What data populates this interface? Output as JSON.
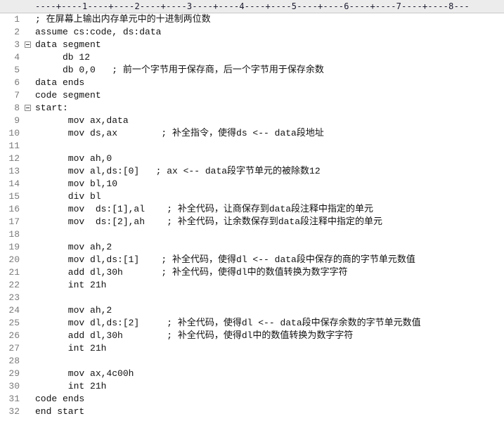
{
  "ruler": "----+----1----+----2----+----3----+----4----+----5----+----6----+----7----+----8---",
  "lines": [
    {
      "num": "1",
      "text": "; 在屏幕上输出内存单元中的十进制两位数",
      "fold": false
    },
    {
      "num": "2",
      "text": "assume cs:code, ds:data",
      "fold": false
    },
    {
      "num": "3",
      "text": "data segment",
      "fold": true
    },
    {
      "num": "4",
      "text": "     db 12",
      "fold": false
    },
    {
      "num": "5",
      "text": "     db 0,0   ; 前一个字节用于保存商，后一个字节用于保存余数",
      "fold": false
    },
    {
      "num": "6",
      "text": "data ends",
      "fold": false
    },
    {
      "num": "7",
      "text": "code segment",
      "fold": false
    },
    {
      "num": "8",
      "text": "start:",
      "fold": true
    },
    {
      "num": "9",
      "text": "      mov ax,data",
      "fold": false
    },
    {
      "num": "10",
      "text": "      mov ds,ax        ; 补全指令，使得ds <-- data段地址",
      "fold": false
    },
    {
      "num": "11",
      "text": "",
      "fold": false
    },
    {
      "num": "12",
      "text": "      mov ah,0",
      "fold": false
    },
    {
      "num": "13",
      "text": "      mov al,ds:[0]   ; ax <-- data段字节单元的被除数12",
      "fold": false
    },
    {
      "num": "14",
      "text": "      mov bl,10",
      "fold": false
    },
    {
      "num": "15",
      "text": "      div bl",
      "fold": false
    },
    {
      "num": "16",
      "text": "      mov  ds:[1],al    ; 补全代码，让商保存到data段注释中指定的单元",
      "fold": false
    },
    {
      "num": "17",
      "text": "      mov  ds:[2],ah    ; 补全代码，让余数保存到data段注释中指定的单元",
      "fold": false
    },
    {
      "num": "18",
      "text": "",
      "fold": false
    },
    {
      "num": "19",
      "text": "      mov ah,2",
      "fold": false
    },
    {
      "num": "20",
      "text": "      mov dl,ds:[1]    ; 补全代码，使得dl <-- data段中保存的商的字节单元数值",
      "fold": false
    },
    {
      "num": "21",
      "text": "      add dl,30h       ; 补全代码，使得dl中的数值转换为数字字符",
      "fold": false
    },
    {
      "num": "22",
      "text": "      int 21h",
      "fold": false
    },
    {
      "num": "23",
      "text": "",
      "fold": false
    },
    {
      "num": "24",
      "text": "      mov ah,2",
      "fold": false
    },
    {
      "num": "25",
      "text": "      mov dl,ds:[2]     ; 补全代码，使得dl <-- data段中保存余数的字节单元数值",
      "fold": false
    },
    {
      "num": "26",
      "text": "      add dl,30h        ; 补全代码，使得dl中的数值转换为数字字符",
      "fold": false
    },
    {
      "num": "27",
      "text": "      int 21h",
      "fold": false
    },
    {
      "num": "28",
      "text": "",
      "fold": false
    },
    {
      "num": "29",
      "text": "      mov ax,4c00h",
      "fold": false
    },
    {
      "num": "30",
      "text": "      int 21h",
      "fold": false
    },
    {
      "num": "31",
      "text": "code ends",
      "fold": false
    },
    {
      "num": "32",
      "text": "end start",
      "fold": false
    }
  ]
}
